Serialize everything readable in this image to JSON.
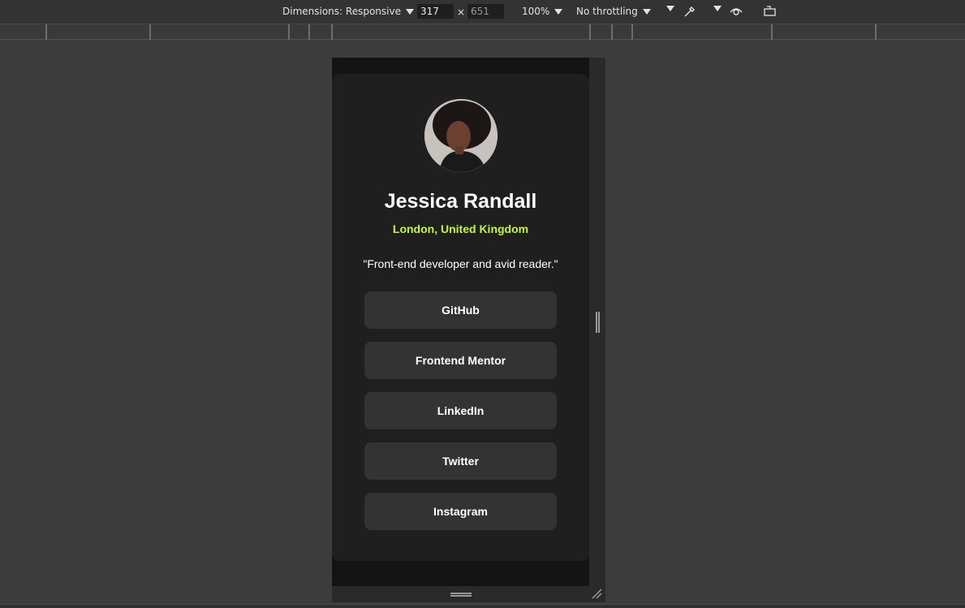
{
  "toolbar": {
    "dimensions_label": "Dimensions: Responsive",
    "width_value": "317",
    "times": "×",
    "height_value": "651",
    "zoom_label": "100%",
    "throttling_label": "No throttling"
  },
  "profile": {
    "name": "Jessica Randall",
    "location": "London, United Kingdom",
    "bio": "\"Front-end developer and avid reader.\"",
    "links": [
      "GitHub",
      "Frontend Mentor",
      "LinkedIn",
      "Twitter",
      "Instagram"
    ]
  },
  "colors": {
    "accent": "#c4f82a",
    "card": "#1f1f1f",
    "button": "#333333",
    "page": "#141414"
  },
  "icons": [
    "caret-down-icon",
    "eyedropper-icon",
    "eye-icon",
    "rotate-device-icon",
    "resize-handle-icon"
  ]
}
